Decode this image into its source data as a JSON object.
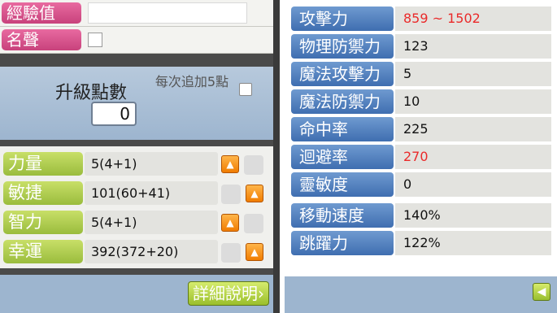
{
  "left": {
    "experience_label": "經驗值",
    "fame_label": "名聲",
    "ap": {
      "title": "升級點數",
      "value": "0",
      "note": "每次追加5點"
    },
    "stats": [
      {
        "label": "力量",
        "value": "5(4+1)"
      },
      {
        "label": "敏捷",
        "value": "101(60+41)"
      },
      {
        "label": "智力",
        "value": "5(4+1)"
      },
      {
        "label": "幸運",
        "value": "392(372+20)"
      }
    ],
    "detail_button": "詳細說明",
    "detail_button_arrow": "›"
  },
  "right": {
    "rows": [
      {
        "label": "攻擊力",
        "value": "859 ~ 1502"
      },
      {
        "label": "物理防禦力",
        "value": "123"
      },
      {
        "label": "魔法攻擊力",
        "value": "5"
      },
      {
        "label": "魔法防禦力",
        "value": "10"
      },
      {
        "label": "命中率",
        "value": "225"
      },
      {
        "label": "迴避率",
        "value": "270"
      },
      {
        "label": "靈敏度",
        "value": "0"
      },
      {
        "label": "移動速度",
        "value": "140%"
      },
      {
        "label": "跳躍力",
        "value": "122%"
      }
    ],
    "back_button": "◀"
  },
  "icons": {
    "up_arrow": "▲"
  },
  "colors": {
    "pink": "#d4558b",
    "green": "#aac84a",
    "blue": "#4f7fbf",
    "red": "#ea2a2a"
  }
}
